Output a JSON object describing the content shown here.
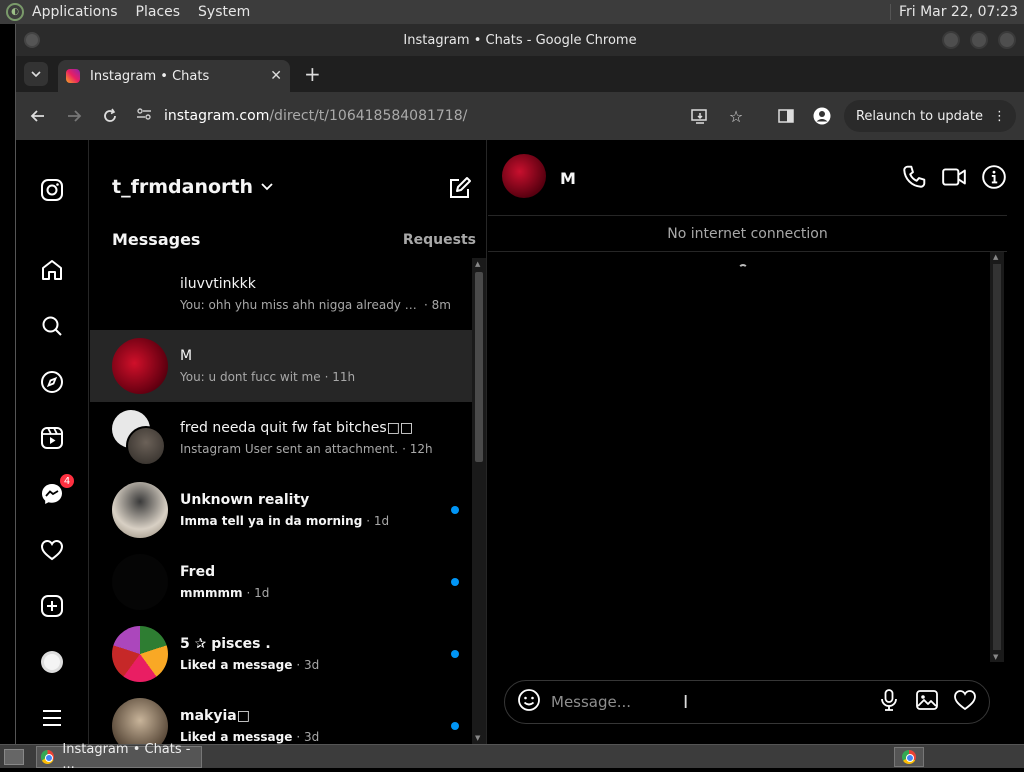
{
  "desktop": {
    "menus": [
      "Applications",
      "Places",
      "System"
    ],
    "clock": "Fri Mar 22, 07:23"
  },
  "window": {
    "title": "Instagram • Chats - Google Chrome"
  },
  "browser": {
    "tab_title": "Instagram • Chats",
    "url_host": "instagram.com",
    "url_path": "/direct/t/106418584081718/",
    "relaunch_label": "Relaunch to update"
  },
  "inbox": {
    "username": "t_frmdanorth",
    "messages_label": "Messages",
    "requests_label": "Requests",
    "threads": [
      {
        "name": "iluvvtinkkk",
        "preview": "You: ohh yhu miss ahh nigga already dats ...",
        "time": " · 8m",
        "unread": false
      },
      {
        "name": "M",
        "preview": "You: u dont fucc wit me",
        "time": " · 11h",
        "unread": false
      },
      {
        "name": "fred needa quit fw fat bitches□□",
        "preview": "Instagram User sent an attachment.",
        "time": " · 12h",
        "unread": false
      },
      {
        "name": "Unknown reality",
        "preview": "Imma tell ya in da morning",
        "time": " · 1d",
        "unread": true
      },
      {
        "name": "Fred",
        "preview": "mmmmm",
        "time": " · 1d",
        "unread": true
      },
      {
        "name": "5 ✰ pisces .",
        "preview": "Liked a message",
        "time": " · 3d",
        "unread": true
      },
      {
        "name": "makyia□",
        "preview": "Liked a message",
        "time": " · 3d",
        "unread": true
      }
    ]
  },
  "nav": {
    "notification_count": "4"
  },
  "chat": {
    "name": "M",
    "status": "No internet connection",
    "composer_placeholder": "Message..."
  },
  "taskbar": {
    "task_label": "Instagram • Chats - ..."
  }
}
